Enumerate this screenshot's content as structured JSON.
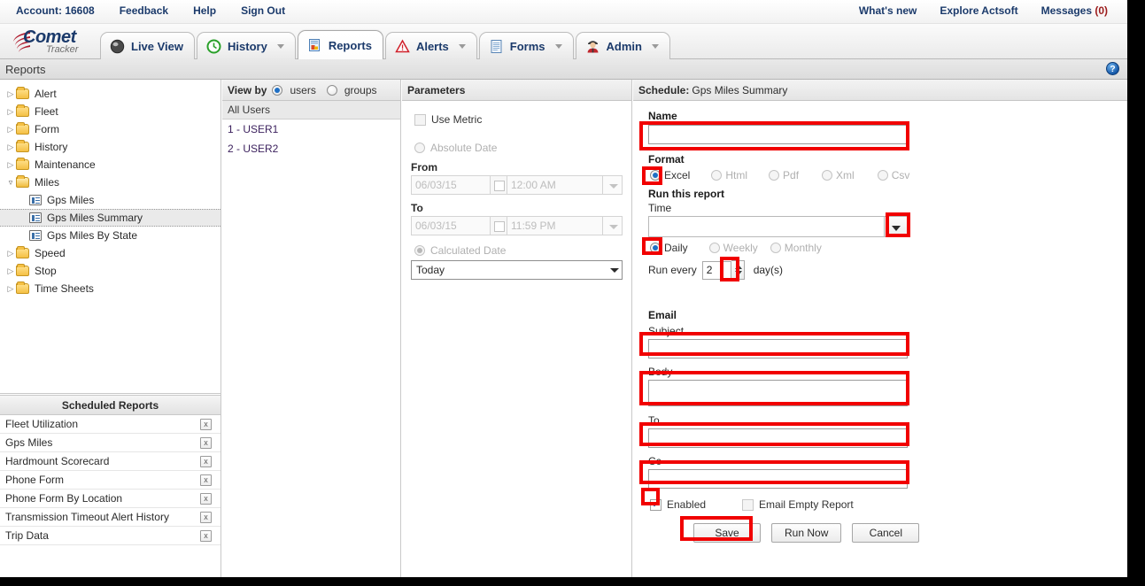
{
  "account_bar": {
    "account_label": "Account: 16608",
    "links": [
      "Feedback",
      "Help",
      "Sign Out"
    ],
    "right_links": [
      {
        "label": "What's new"
      },
      {
        "label": "Explore Actsoft"
      },
      {
        "label": "Messages ",
        "count": "(0)"
      }
    ]
  },
  "logo": {
    "comet": "Comet",
    "tracker": "Tracker"
  },
  "tabs": [
    {
      "label": "Live View",
      "icon": "globe-icon",
      "caret": false,
      "active": false
    },
    {
      "label": "History",
      "icon": "clock-icon",
      "caret": true,
      "active": false
    },
    {
      "label": "Reports",
      "icon": "report-icon",
      "caret": false,
      "active": true
    },
    {
      "label": "Alerts",
      "icon": "warning-triangle-icon",
      "caret": true,
      "active": false
    },
    {
      "label": "Forms",
      "icon": "document-icon",
      "caret": true,
      "active": false
    },
    {
      "label": "Admin",
      "icon": "person-icon",
      "caret": true,
      "active": false
    }
  ],
  "page": {
    "title": "Reports",
    "help_icon_glyph": "?"
  },
  "tree": {
    "nodes": [
      {
        "label": "Alert",
        "type": "folder",
        "open": false,
        "indent": 0,
        "selected": false
      },
      {
        "label": "Fleet",
        "type": "folder",
        "open": false,
        "indent": 0,
        "selected": false
      },
      {
        "label": "Form",
        "type": "folder",
        "open": false,
        "indent": 0,
        "selected": false
      },
      {
        "label": "History",
        "type": "folder",
        "open": false,
        "indent": 0,
        "selected": false
      },
      {
        "label": "Maintenance",
        "type": "folder",
        "open": false,
        "indent": 0,
        "selected": false
      },
      {
        "label": "Miles",
        "type": "folder",
        "open": true,
        "indent": 0,
        "selected": false
      },
      {
        "label": "Gps Miles",
        "type": "report",
        "open": false,
        "indent": 1,
        "selected": false
      },
      {
        "label": "Gps Miles Summary",
        "type": "report",
        "open": false,
        "indent": 1,
        "selected": true
      },
      {
        "label": "Gps Miles By State",
        "type": "report",
        "open": false,
        "indent": 1,
        "selected": false
      },
      {
        "label": "Speed",
        "type": "folder",
        "open": false,
        "indent": 0,
        "selected": false
      },
      {
        "label": "Stop",
        "type": "folder",
        "open": false,
        "indent": 0,
        "selected": false
      },
      {
        "label": "Time Sheets",
        "type": "folder",
        "open": false,
        "indent": 0,
        "selected": false
      }
    ]
  },
  "scheduled_reports": {
    "title": "Scheduled Reports",
    "delete_glyph": "x",
    "items": [
      {
        "name": "Fleet Utilization"
      },
      {
        "name": "Gps Miles"
      },
      {
        "name": "Hardmount Scorecard"
      },
      {
        "name": "Phone Form"
      },
      {
        "name": "Phone Form By Location"
      },
      {
        "name": "Transmission Timeout Alert History"
      },
      {
        "name": "Trip Data"
      }
    ]
  },
  "view_by": {
    "header": "View by",
    "options": [
      {
        "label": "users",
        "selected": true
      },
      {
        "label": "groups",
        "selected": false
      }
    ],
    "all_users_label": "All Users",
    "users": [
      "1 - USER1",
      "2 - USER2"
    ]
  },
  "parameters": {
    "header": "Parameters",
    "use_metric": {
      "label": "Use Metric",
      "checked": false,
      "enabled": false
    },
    "absolute_date": {
      "label": "Absolute Date",
      "selected": false,
      "enabled": false
    },
    "from_label": "From",
    "from_date": "06/03/15",
    "from_time": "12:00 AM",
    "to_label": "To",
    "to_date": "06/03/15",
    "to_time": "11:59 PM",
    "calculated_date": {
      "label": "Calculated Date",
      "selected": true,
      "enabled": false
    },
    "calculated_value": "Today"
  },
  "schedule": {
    "header_prefix": "Schedule: ",
    "header_report": "Gps Miles Summary",
    "name_label": "Name",
    "name_value": "",
    "format_label": "Format",
    "formats": [
      {
        "label": "Excel",
        "selected": true
      },
      {
        "label": "Html",
        "selected": false
      },
      {
        "label": "Pdf",
        "selected": false
      },
      {
        "label": "Xml",
        "selected": false
      },
      {
        "label": "Csv",
        "selected": false
      }
    ],
    "run_this_report_label": "Run this report",
    "time_label": "Time",
    "time_value": "",
    "frequencies": [
      {
        "label": "Daily",
        "selected": true
      },
      {
        "label": "Weekly",
        "selected": false
      },
      {
        "label": "Monthly",
        "selected": false
      }
    ],
    "run_every_label": "Run every",
    "run_every_value": "2",
    "run_every_unit": "day(s)",
    "email_label": "Email",
    "subject_label": "Subject",
    "subject_value": "",
    "body_label": "Body",
    "body_value": "",
    "to_label": "To",
    "to_value": "",
    "cc_label": "Cc",
    "cc_value": "",
    "enabled_checkbox": {
      "label": "Enabled",
      "checked": true
    },
    "email_empty_checkbox": {
      "label": "Email Empty Report",
      "checked": false
    },
    "buttons": [
      {
        "label": "Save",
        "highlighted": true
      },
      {
        "label": "Run Now",
        "highlighted": false
      },
      {
        "label": "Cancel",
        "highlighted": false
      }
    ]
  },
  "annotation": {
    "color": "#f10000"
  }
}
